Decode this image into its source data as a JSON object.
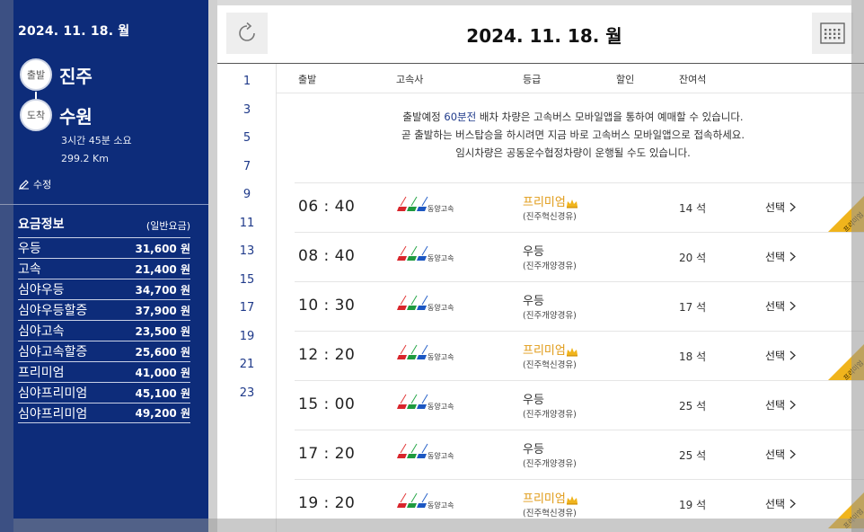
{
  "left": {
    "date": "2024. 11. 18. 월",
    "depart_badge": "출발",
    "depart_name": "진주",
    "arrive_badge": "도착",
    "arrive_name": "수원",
    "duration": "3시간 45분 소요",
    "distance": "299.2 Km",
    "edit_label": "수정",
    "fare_title": "요금정보",
    "fare_subtitle": "(일반요금)",
    "fares": [
      {
        "name": "우등",
        "price": "31,600 원"
      },
      {
        "name": "고속",
        "price": "21,400 원"
      },
      {
        "name": "심야우등",
        "price": "34,700 원"
      },
      {
        "name": "심야우등할증",
        "price": "37,900 원"
      },
      {
        "name": "심야고속",
        "price": "23,500 원"
      },
      {
        "name": "심야고속할증",
        "price": "25,600 원"
      },
      {
        "name": "프리미엄",
        "price": "41,000 원"
      },
      {
        "name": "심야프리미엄",
        "price": "45,100 원"
      },
      {
        "name": "심야프리미엄",
        "price": "49,200 원"
      }
    ]
  },
  "header": {
    "title": "2024. 11. 18. 월",
    "refresh_icon": "refresh-icon",
    "calendar_icon": "calendar-icon"
  },
  "hours": [
    "1",
    "3",
    "5",
    "7",
    "9",
    "11",
    "13",
    "15",
    "17",
    "19",
    "21",
    "23"
  ],
  "columns": {
    "depart": "출발",
    "company": "고속사",
    "grade": "등급",
    "discount": "할인",
    "seats": "잔여석"
  },
  "notice": {
    "line1_prefix": "출발예정 ",
    "line1_highlight": "60분전",
    "line1_suffix": " 배차 차량은 고속버스 모바일앱을 통하여 예매할 수 있습니다.",
    "line2": "곧 출발하는 버스탑승을 하시려면 지금 바로 고속버스 모바일앱으로 접속하세요.",
    "line3": "임시차량은 공동운수협정차량이 운행될 수도 있습니다."
  },
  "schedules": [
    {
      "time": "06 : 40",
      "company": "동양고속",
      "grade": "프리미엄",
      "route": "(진주혁신경유)",
      "seats": "14 석",
      "select": "선택",
      "premium": true,
      "ribbon": "프리미엄"
    },
    {
      "time": "08 : 40",
      "company": "동양고속",
      "grade": "우등",
      "route": "(진주개양경유)",
      "seats": "20 석",
      "select": "선택",
      "premium": false,
      "ribbon": ""
    },
    {
      "time": "10 : 30",
      "company": "동양고속",
      "grade": "우등",
      "route": "(진주개양경유)",
      "seats": "17 석",
      "select": "선택",
      "premium": false,
      "ribbon": ""
    },
    {
      "time": "12 : 20",
      "company": "동양고속",
      "grade": "프리미엄",
      "route": "(진주혁신경유)",
      "seats": "18 석",
      "select": "선택",
      "premium": true,
      "ribbon": "프리미엄"
    },
    {
      "time": "15 : 00",
      "company": "동양고속",
      "grade": "우등",
      "route": "(진주개양경유)",
      "seats": "25 석",
      "select": "선택",
      "premium": false,
      "ribbon": ""
    },
    {
      "time": "17 : 20",
      "company": "동양고속",
      "grade": "우등",
      "route": "(진주개양경유)",
      "seats": "25 석",
      "select": "선택",
      "premium": false,
      "ribbon": ""
    },
    {
      "time": "19 : 20",
      "company": "동양고속",
      "grade": "프리미엄",
      "route": "(진주혁신경유)",
      "seats": "19 석",
      "select": "선택",
      "premium": true,
      "ribbon": "프리미엄"
    }
  ],
  "colors": {
    "sidebar": "#0d2c7a",
    "premium": "#e09a16",
    "ribbon": "#f0b41c",
    "accent": "#1f3a8a"
  }
}
